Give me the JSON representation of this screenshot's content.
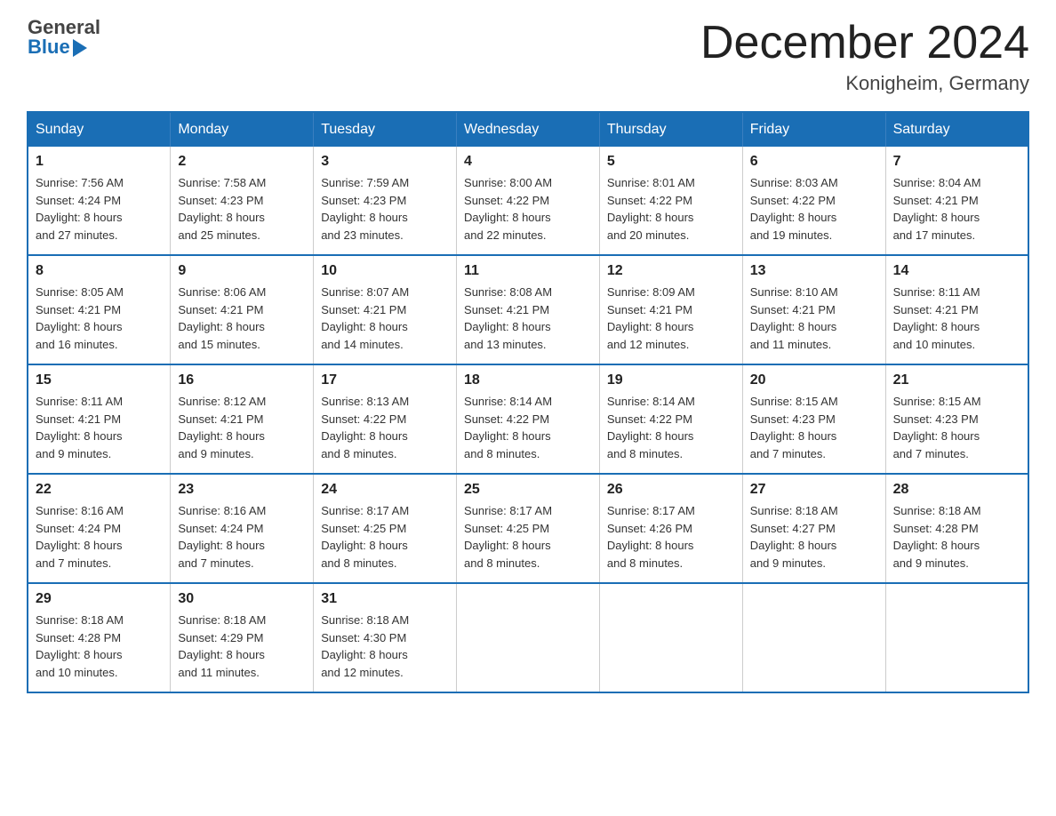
{
  "header": {
    "logo_general": "General",
    "logo_blue": "Blue",
    "month_title": "December 2024",
    "location": "Konigheim, Germany"
  },
  "weekdays": [
    "Sunday",
    "Monday",
    "Tuesday",
    "Wednesday",
    "Thursday",
    "Friday",
    "Saturday"
  ],
  "weeks": [
    [
      {
        "day": "1",
        "sunrise": "7:56 AM",
        "sunset": "4:24 PM",
        "daylight": "8 hours and 27 minutes."
      },
      {
        "day": "2",
        "sunrise": "7:58 AM",
        "sunset": "4:23 PM",
        "daylight": "8 hours and 25 minutes."
      },
      {
        "day": "3",
        "sunrise": "7:59 AM",
        "sunset": "4:23 PM",
        "daylight": "8 hours and 23 minutes."
      },
      {
        "day": "4",
        "sunrise": "8:00 AM",
        "sunset": "4:22 PM",
        "daylight": "8 hours and 22 minutes."
      },
      {
        "day": "5",
        "sunrise": "8:01 AM",
        "sunset": "4:22 PM",
        "daylight": "8 hours and 20 minutes."
      },
      {
        "day": "6",
        "sunrise": "8:03 AM",
        "sunset": "4:22 PM",
        "daylight": "8 hours and 19 minutes."
      },
      {
        "day": "7",
        "sunrise": "8:04 AM",
        "sunset": "4:21 PM",
        "daylight": "8 hours and 17 minutes."
      }
    ],
    [
      {
        "day": "8",
        "sunrise": "8:05 AM",
        "sunset": "4:21 PM",
        "daylight": "8 hours and 16 minutes."
      },
      {
        "day": "9",
        "sunrise": "8:06 AM",
        "sunset": "4:21 PM",
        "daylight": "8 hours and 15 minutes."
      },
      {
        "day": "10",
        "sunrise": "8:07 AM",
        "sunset": "4:21 PM",
        "daylight": "8 hours and 14 minutes."
      },
      {
        "day": "11",
        "sunrise": "8:08 AM",
        "sunset": "4:21 PM",
        "daylight": "8 hours and 13 minutes."
      },
      {
        "day": "12",
        "sunrise": "8:09 AM",
        "sunset": "4:21 PM",
        "daylight": "8 hours and 12 minutes."
      },
      {
        "day": "13",
        "sunrise": "8:10 AM",
        "sunset": "4:21 PM",
        "daylight": "8 hours and 11 minutes."
      },
      {
        "day": "14",
        "sunrise": "8:11 AM",
        "sunset": "4:21 PM",
        "daylight": "8 hours and 10 minutes."
      }
    ],
    [
      {
        "day": "15",
        "sunrise": "8:11 AM",
        "sunset": "4:21 PM",
        "daylight": "8 hours and 9 minutes."
      },
      {
        "day": "16",
        "sunrise": "8:12 AM",
        "sunset": "4:21 PM",
        "daylight": "8 hours and 9 minutes."
      },
      {
        "day": "17",
        "sunrise": "8:13 AM",
        "sunset": "4:22 PM",
        "daylight": "8 hours and 8 minutes."
      },
      {
        "day": "18",
        "sunrise": "8:14 AM",
        "sunset": "4:22 PM",
        "daylight": "8 hours and 8 minutes."
      },
      {
        "day": "19",
        "sunrise": "8:14 AM",
        "sunset": "4:22 PM",
        "daylight": "8 hours and 8 minutes."
      },
      {
        "day": "20",
        "sunrise": "8:15 AM",
        "sunset": "4:23 PM",
        "daylight": "8 hours and 7 minutes."
      },
      {
        "day": "21",
        "sunrise": "8:15 AM",
        "sunset": "4:23 PM",
        "daylight": "8 hours and 7 minutes."
      }
    ],
    [
      {
        "day": "22",
        "sunrise": "8:16 AM",
        "sunset": "4:24 PM",
        "daylight": "8 hours and 7 minutes."
      },
      {
        "day": "23",
        "sunrise": "8:16 AM",
        "sunset": "4:24 PM",
        "daylight": "8 hours and 7 minutes."
      },
      {
        "day": "24",
        "sunrise": "8:17 AM",
        "sunset": "4:25 PM",
        "daylight": "8 hours and 8 minutes."
      },
      {
        "day": "25",
        "sunrise": "8:17 AM",
        "sunset": "4:25 PM",
        "daylight": "8 hours and 8 minutes."
      },
      {
        "day": "26",
        "sunrise": "8:17 AM",
        "sunset": "4:26 PM",
        "daylight": "8 hours and 8 minutes."
      },
      {
        "day": "27",
        "sunrise": "8:18 AM",
        "sunset": "4:27 PM",
        "daylight": "8 hours and 9 minutes."
      },
      {
        "day": "28",
        "sunrise": "8:18 AM",
        "sunset": "4:28 PM",
        "daylight": "8 hours and 9 minutes."
      }
    ],
    [
      {
        "day": "29",
        "sunrise": "8:18 AM",
        "sunset": "4:28 PM",
        "daylight": "8 hours and 10 minutes."
      },
      {
        "day": "30",
        "sunrise": "8:18 AM",
        "sunset": "4:29 PM",
        "daylight": "8 hours and 11 minutes."
      },
      {
        "day": "31",
        "sunrise": "8:18 AM",
        "sunset": "4:30 PM",
        "daylight": "8 hours and 12 minutes."
      },
      null,
      null,
      null,
      null
    ]
  ],
  "labels": {
    "sunrise": "Sunrise:",
    "sunset": "Sunset:",
    "daylight": "Daylight:"
  }
}
